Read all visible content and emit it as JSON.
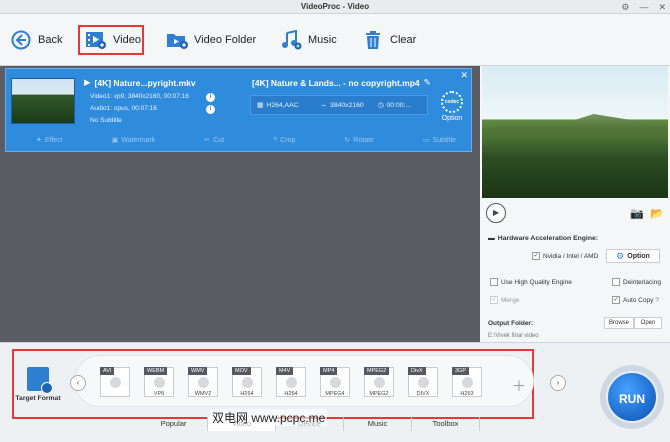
{
  "window": {
    "title": "VideoProc - Video"
  },
  "toolbar": {
    "back": "Back",
    "video": "Video",
    "video_folder": "Video Folder",
    "music": "Music",
    "clear": "Clear"
  },
  "task": {
    "source_name": "[4K] Nature...pyright.mkv",
    "source_video": "Video1: vp9, 3840x2160, 00:07:16",
    "source_audio": "Audio1: opus, 00:07:16",
    "source_subtitle": "No Subtitle",
    "output_name": "[4K] Nature & Lands... - no copyright.mp4",
    "output_codec": "H264,AAC",
    "output_resolution": "3840x2160",
    "output_duration": "00:00:...",
    "codec_option_label": "Option",
    "codec_gear_text": "codec",
    "edit_tools": [
      "Effect",
      "Watermark",
      "Cut",
      "Crop",
      "Rotate",
      "Subtitle"
    ]
  },
  "settings": {
    "hw_title": "Hardware Acceleration Engine:",
    "hw_vendor": "Nvidia / Intel / AMD",
    "option_btn": "Option",
    "high_quality": "Use High Quality Engine",
    "deinterlacing": "Deinterlacing",
    "merge": "Merge",
    "auto_copy": "Auto Copy",
    "output_folder_label": "Output Folder:",
    "browse": "Browse",
    "open": "Open",
    "output_path": "E:\\Vivek final video"
  },
  "formats": {
    "target_label": "Target Format",
    "items": [
      {
        "tag": "AVI",
        "sub": ""
      },
      {
        "tag": "WEBM",
        "sub": "VP8"
      },
      {
        "tag": "WMV",
        "sub": "WMV2"
      },
      {
        "tag": "MOV",
        "sub": "H264"
      },
      {
        "tag": "M4V",
        "sub": "H264"
      },
      {
        "tag": "MP4",
        "sub": "MPEG4"
      },
      {
        "tag": "MPEG2",
        "sub": "MPEG2"
      },
      {
        "tag": "DivX",
        "sub": "DIVX"
      },
      {
        "tag": "3GP",
        "sub": "H263"
      }
    ]
  },
  "tabs": [
    "Popular",
    "Video",
    "Device",
    "Music",
    "Toolbox"
  ],
  "run_label": "RUN",
  "watermark_text": "双电网 www.pcpc.me"
}
